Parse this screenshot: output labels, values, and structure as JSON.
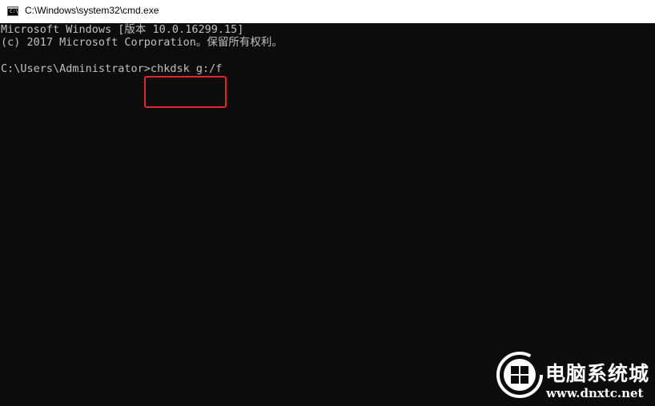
{
  "window": {
    "title": "C:\\Windows\\system32\\cmd.exe",
    "icon": "cmd-icon",
    "icon_prompt": "C:\\"
  },
  "console": {
    "lines": [
      "Microsoft Windows [版本 10.0.16299.15]",
      "(c) 2017 Microsoft Corporation。保留所有权利。",
      "",
      "C:\\Users\\Administrator>chkdsk g:/f"
    ],
    "highlighted_command": "chkdsk g:/f",
    "highlight_color": "#e3262a",
    "text_color": "#c0c0c0",
    "background_color": "#0c0c0c"
  },
  "watermark": {
    "name": "电脑系统城",
    "url": "www.dnxtc.net",
    "icon": "windows-logo-icon"
  }
}
